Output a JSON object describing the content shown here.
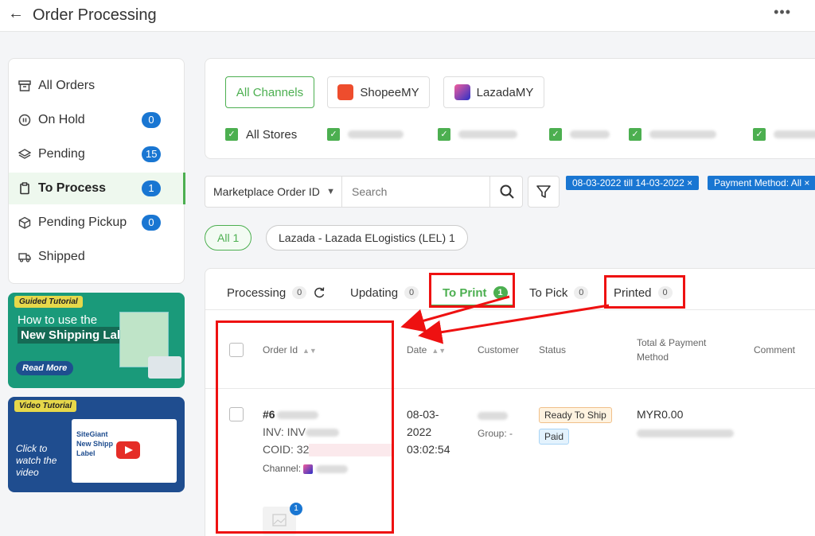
{
  "header": {
    "back_icon": "arrow-left-icon",
    "title": "Order Processing",
    "more_icon": "more-horizontal-icon"
  },
  "sidebar": {
    "items": [
      {
        "label": "All Orders",
        "icon": "archive-icon",
        "count": null
      },
      {
        "label": "On Hold",
        "icon": "pause-circle-icon",
        "count": "0"
      },
      {
        "label": "Pending",
        "icon": "layers-icon",
        "count": "15"
      },
      {
        "label": "To Process",
        "icon": "clipboard-icon",
        "count": "1",
        "active": true
      },
      {
        "label": "Pending Pickup",
        "icon": "box-icon",
        "count": "0"
      },
      {
        "label": "Shipped",
        "icon": "truck-icon",
        "count": null
      }
    ]
  },
  "banners": {
    "guided": {
      "tag": "Guided Tutorial",
      "line1": "How to use the",
      "line2": "New Shipping Label?",
      "cta": "Read More"
    },
    "video": {
      "tag": "Video Tutorial",
      "cta": "Click to watch the video",
      "thumb_brand": "SiteGiant",
      "thumb_title1": "New Shipp",
      "thumb_title2": "Label"
    }
  },
  "channels": {
    "buttons": [
      {
        "label": "All Channels",
        "selected": true
      },
      {
        "label": "ShopeeMY",
        "icon": "shopee-icon"
      },
      {
        "label": "LazadaMY",
        "icon": "lazada-icon"
      }
    ],
    "all_stores_label": "All Stores"
  },
  "search": {
    "field_select": "Marketplace Order ID",
    "placeholder": "Search",
    "search_icon": "search-icon",
    "filter_icon": "filter-icon"
  },
  "filter_chips": [
    "08-03-2022 till 14-03-2022 ×",
    "Payment Method: All ×"
  ],
  "shipping_pills": [
    {
      "label": "All 1",
      "selected": true
    },
    {
      "label": "Lazada - Lazada ELogistics (LEL) 1"
    }
  ],
  "tabs": [
    {
      "label": "Processing",
      "count": "0",
      "refresh_icon": "refresh-icon"
    },
    {
      "label": "Updating",
      "count": "0"
    },
    {
      "label": "To Print",
      "count": "1",
      "active": true
    },
    {
      "label": "To Pick",
      "count": "0"
    },
    {
      "label": "Printed",
      "count": "0"
    }
  ],
  "table": {
    "headers": {
      "order_id": "Order Id",
      "date": "Date",
      "customer": "Customer",
      "status": "Status",
      "total_line1": "Total & Payment",
      "total_line2": "Method",
      "comment": "Comment"
    },
    "row": {
      "order_id": "#6",
      "inv": "INV: INV",
      "coid": "COID: 32",
      "channel_label": "Channel:",
      "date_line1": "08-03-",
      "date_line2": "2022",
      "date_line3": "03:02:54",
      "group": "Group: -",
      "status_ready": "Ready To Ship",
      "status_paid": "Paid",
      "total": "MYR0.00",
      "thumb_badge": "1"
    }
  },
  "colors": {
    "accent_green": "#4caf50",
    "primary_blue": "#1976d2",
    "annotation_red": "#e11111"
  }
}
